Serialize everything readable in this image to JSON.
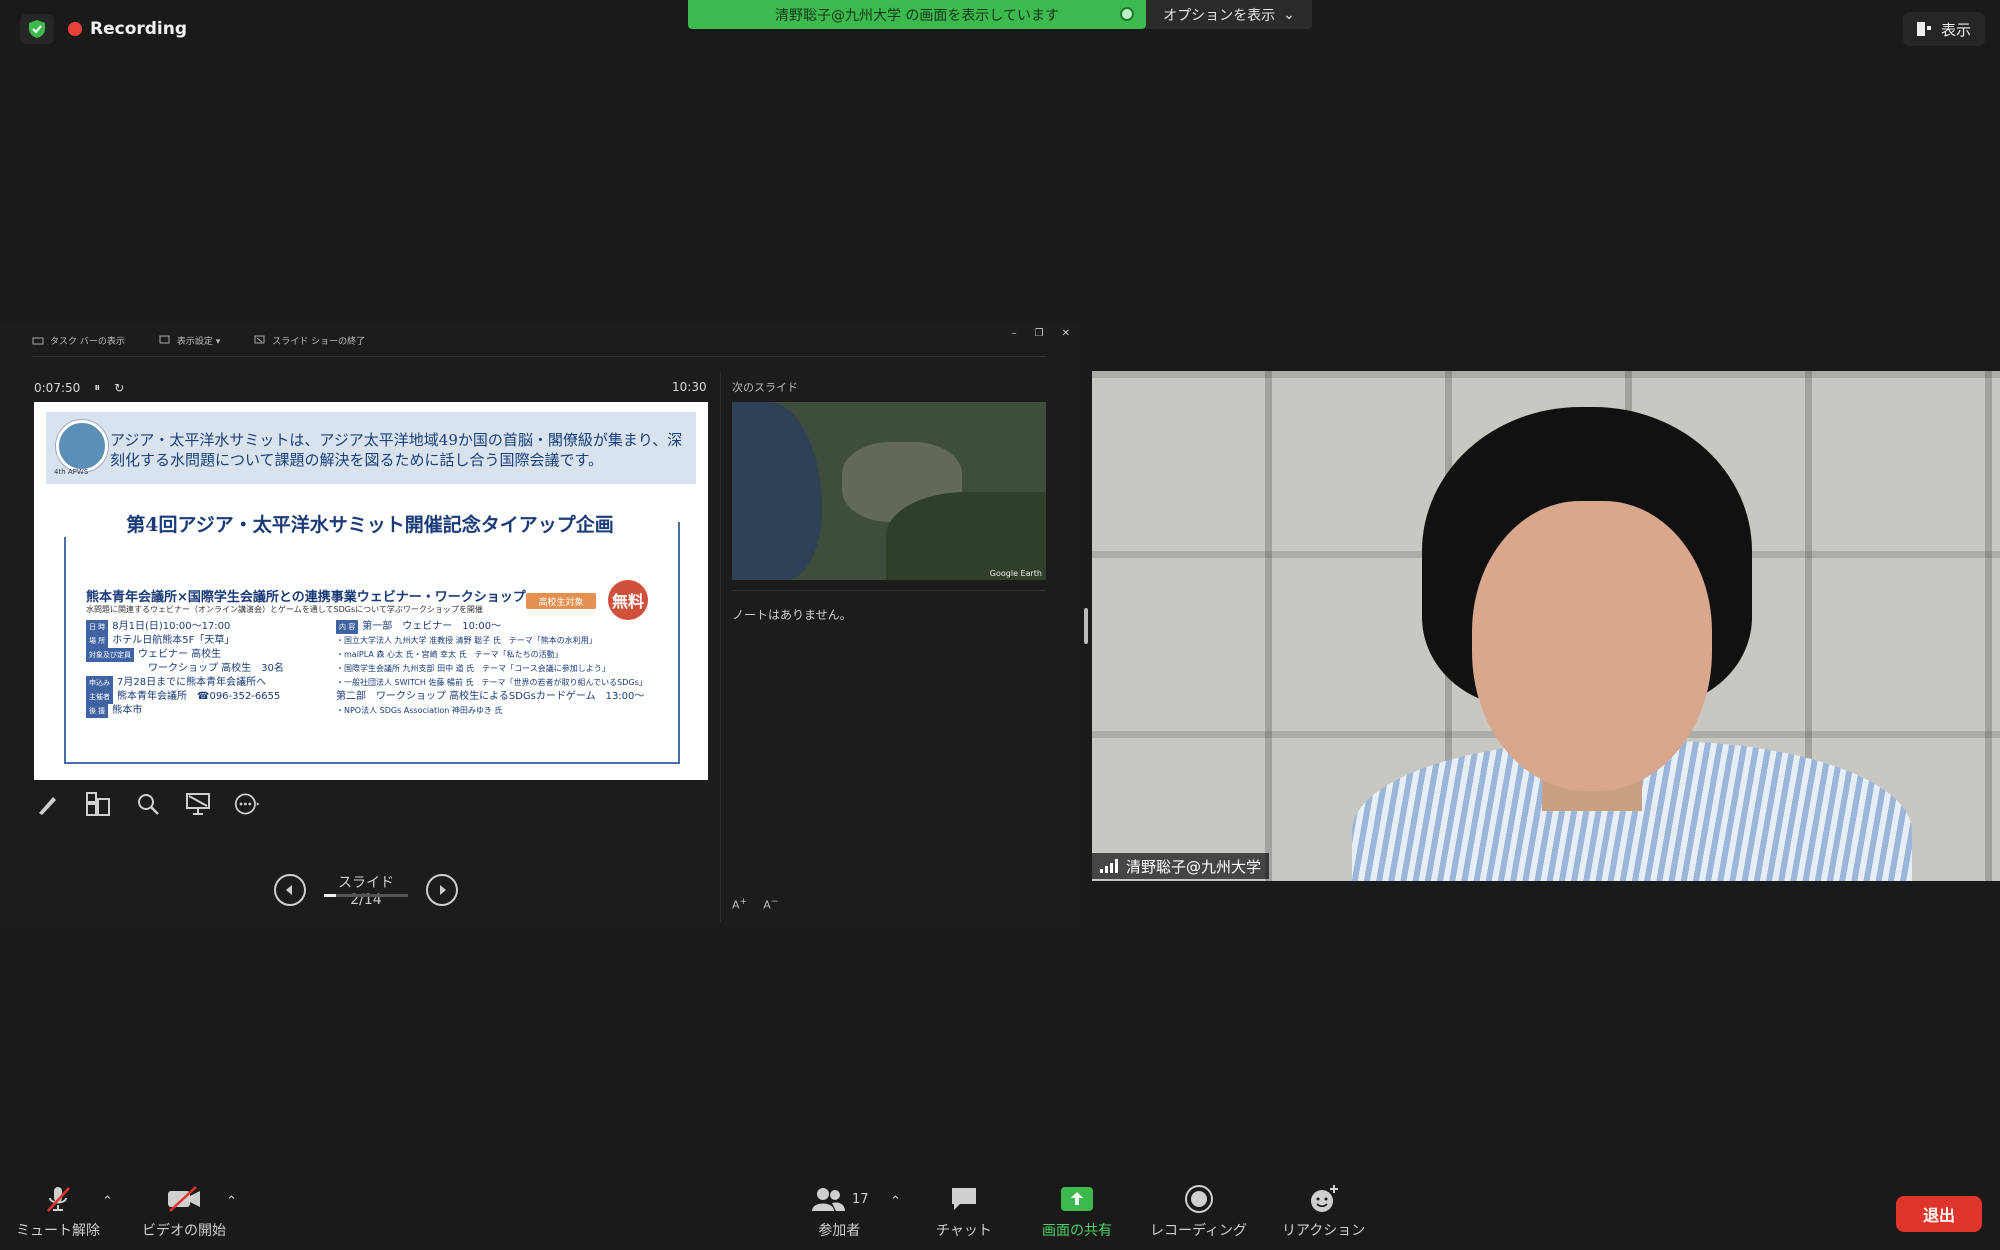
{
  "top": {
    "recording_label": "Recording",
    "share_banner": "清野聡子@九州大学 の画面を表示しています",
    "options_label": "オプションを表示",
    "view_label": "表示"
  },
  "presenter": {
    "toolbar": {
      "taskbar": "タスク バーの表示",
      "display_settings": "表示設定 ▾",
      "end_slideshow": "スライド ショーの終了"
    },
    "elapsed": "0:07:50",
    "clock": "10:30",
    "next_slide_label": "次のスライド",
    "notes": "ノートはありません。",
    "slide_counter": "スライド 2/14",
    "slide_progress": 0.143,
    "font_larger": "A",
    "font_smaller": "A",
    "next_slide_credit": "Google Earth"
  },
  "slide": {
    "logo_text": "4th APWS",
    "intro": "アジア・太平洋水サミットは、アジア太平洋地域49か国の首脳・閣僚級が集まり、深刻化する水問題について課題の解決を図るために話し合う国際会議です。",
    "title": "第4回アジア・太平洋水サミット開催記念タイアップ企画",
    "subtitle": "熊本青年会議所×国際学生会議所との連携事業ウェビナー・ワークショップ",
    "subtitle_note": "水問題に関連するウェビナー（オンライン講演会）とゲームを通してSDGsについて学ぶワークショップを開催",
    "badge": "高校生対象",
    "free": "無料",
    "rows": [
      {
        "tag": "日 時",
        "text": "8月1日(日)10:00〜17:00",
        "tag2": "内 容",
        "text2": "第一部　ウェビナー　10:00〜"
      },
      {
        "tag": "場 所",
        "text": "ホテル日航熊本5F「天草」",
        "tag2": "",
        "text2": "・国立大学法人 九州大学 准教授 清野 聡子 氏　テーマ「熊本の水利用」"
      },
      {
        "tag": "対象及び定員",
        "text": "ウェビナー 高校生",
        "tag2": "",
        "text2": "・maiPLA 森 心太 氏・宮崎 幸太 氏　テーマ「私たちの活動」"
      },
      {
        "tag": "",
        "text": "ワークショップ 高校生　30名",
        "tag2": "",
        "text2": "・国際学生会議所 九州支部 田中 道 氏　テーマ「コース会議に参加しよう」"
      },
      {
        "tag": "申込み",
        "text": "7月28日までに熊本青年会議所へ",
        "tag2": "",
        "text2": "・一般社団法人 SWITCH 佐藤 暢前 氏　テーマ「世界の若者が取り組んでいるSDGs」"
      },
      {
        "tag": "主催者",
        "text": "熊本青年会議所　☎096-352-6655",
        "tag2": "",
        "text2": "第二部　ワークショップ 高校生によるSDGsカードゲーム　13:00〜"
      },
      {
        "tag": "後 援",
        "text": "熊本市",
        "tag2": "",
        "text2": "・NPO法人 SDGs Association 神田みゆき 氏"
      }
    ]
  },
  "video": {
    "participant_name": "清野聡子@九州大学"
  },
  "controls": {
    "mute": "ミュート解除",
    "video": "ビデオの開始",
    "participants": "参加者",
    "participant_count": "17",
    "chat": "チャット",
    "share": "画面の共有",
    "recording": "レコーディング",
    "reactions": "リアクション",
    "leave": "退出"
  },
  "colors": {
    "share_green": "#3dba4e",
    "leave_red": "#e0352b",
    "recording_red": "#e8413a"
  }
}
